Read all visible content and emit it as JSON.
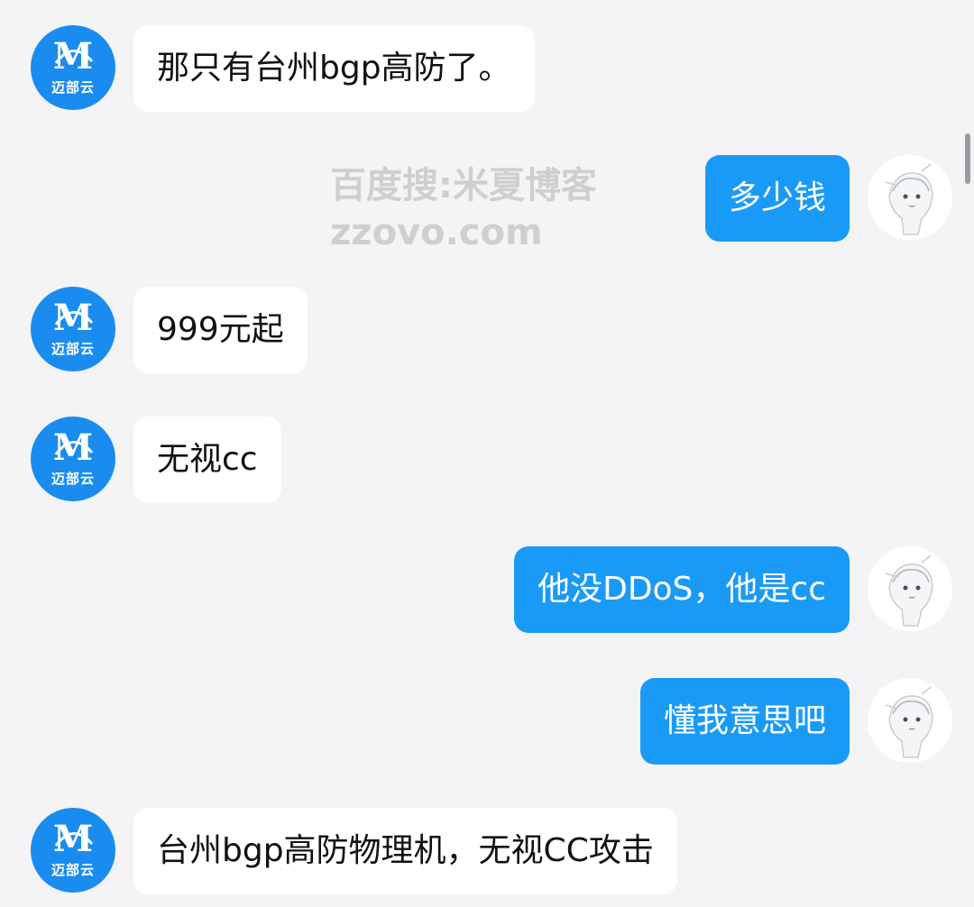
{
  "colors": {
    "background": "#f4f4f6",
    "incoming_bubble": "#ffffff",
    "outgoing_bubble": "#1a9af7",
    "brand_avatar": "#1a8cf0",
    "watermark": "#cfcfd2"
  },
  "contact": {
    "avatar_icon": "brand-logo-icon",
    "logo_letter": "M",
    "name_on_logo": "迈部云"
  },
  "self": {
    "avatar_icon": "anime-girl-avatar-icon"
  },
  "watermark": {
    "line1": "百度搜:米夏博客",
    "line2": "zzovo.com"
  },
  "messages": [
    {
      "side": "in",
      "text": "那只有台州bgp高防了。"
    },
    {
      "side": "out",
      "text": "多少钱"
    },
    {
      "side": "in",
      "text": "999元起"
    },
    {
      "side": "in",
      "text": "无视cc"
    },
    {
      "side": "out",
      "text": "他没DDoS，他是cc"
    },
    {
      "side": "out",
      "text": "懂我意思吧"
    },
    {
      "side": "in",
      "text": "台州bgp高防物理机，无视CC攻击"
    }
  ]
}
